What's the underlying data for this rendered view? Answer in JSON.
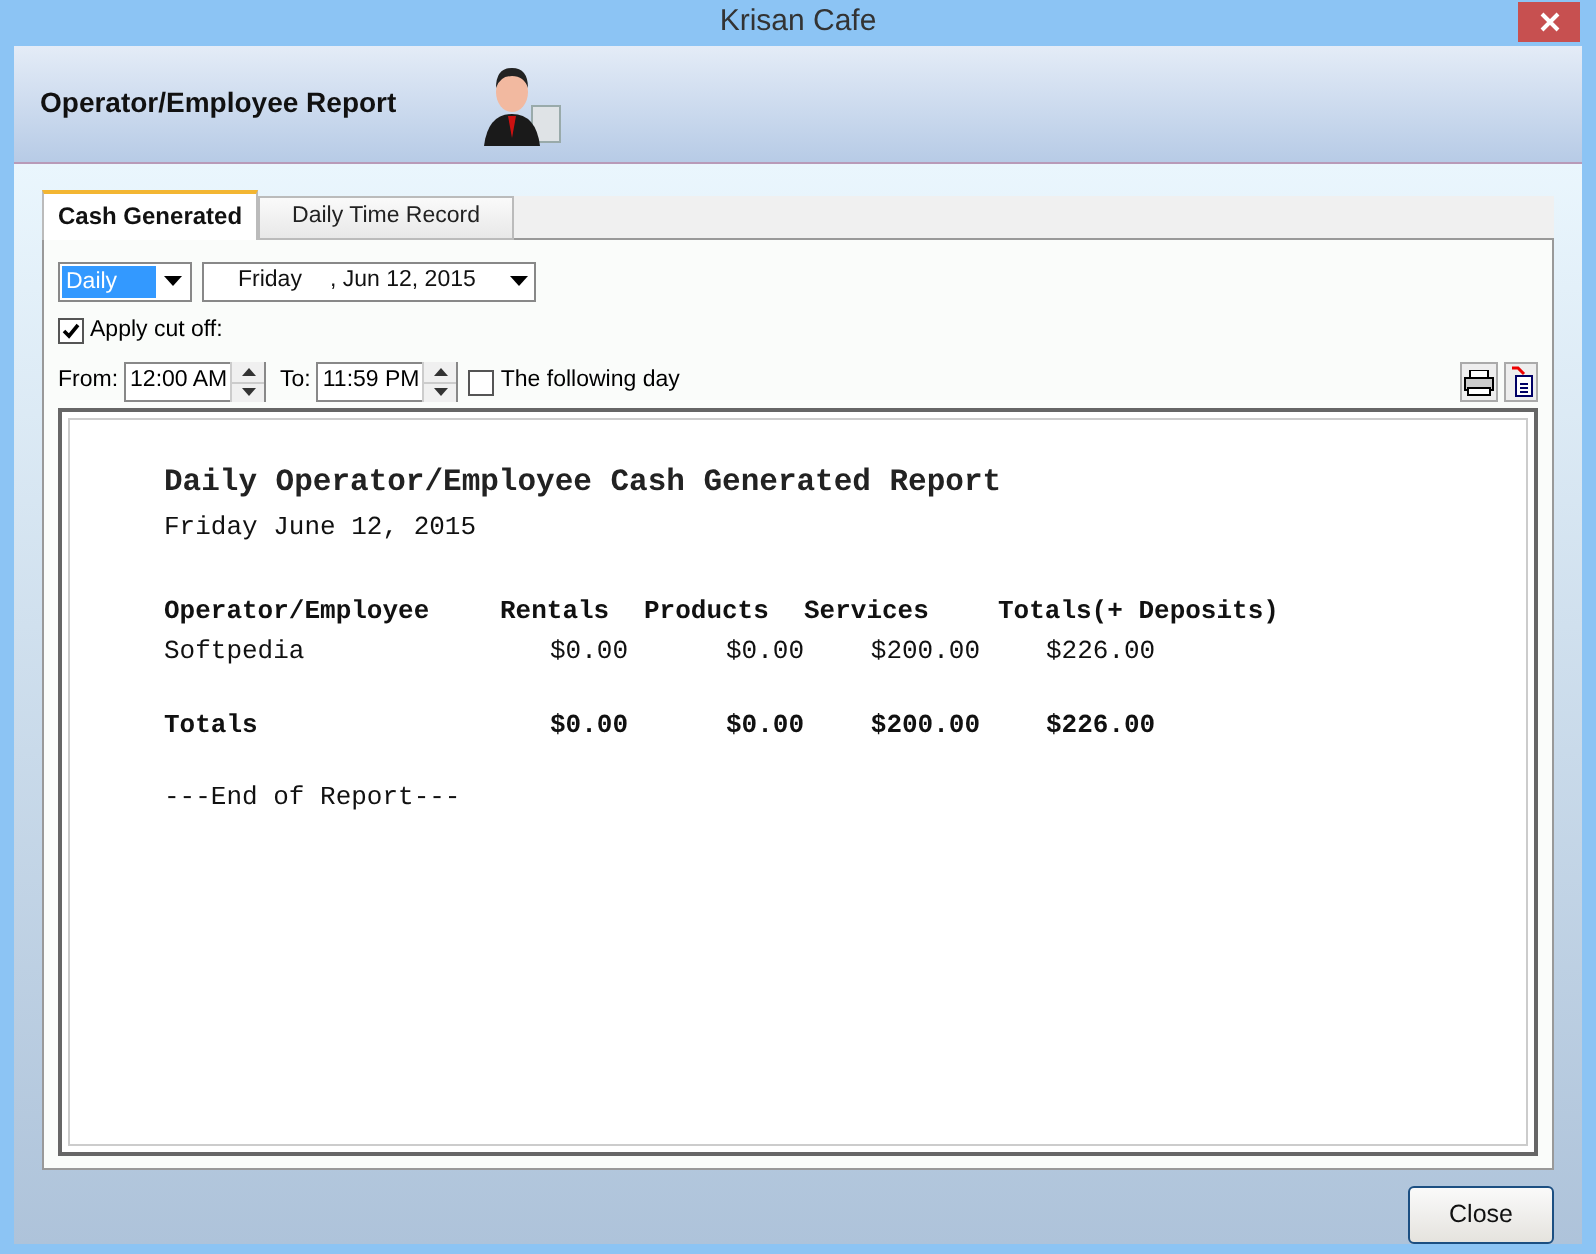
{
  "window": {
    "title": "Krisan Cafe"
  },
  "header": {
    "title": "Operator/Employee Report"
  },
  "tabs": [
    {
      "label": "Cash Generated",
      "selected": true
    },
    {
      "label": "Daily Time Record",
      "selected": false
    }
  ],
  "period": {
    "value": "Daily"
  },
  "date": {
    "day": "Friday",
    "rest": ", Jun 12, 2015"
  },
  "apply_cut_off": {
    "label": "Apply cut off:",
    "checked": true
  },
  "from": {
    "label": "From:",
    "value": "12:00 AM"
  },
  "to": {
    "label": "To:",
    "value": "11:59 PM"
  },
  "following_day": {
    "label": "The following day",
    "checked": false
  },
  "report": {
    "title": "Daily Operator/Employee Cash Generated Report",
    "date": "Friday June 12, 2015",
    "columns": [
      "Operator/Employee",
      "Rentals",
      "Products",
      "Services",
      "Totals(+ Deposits)"
    ],
    "rows": [
      [
        "Softpedia",
        "$0.00",
        "$0.00",
        "$200.00",
        "$226.00"
      ]
    ],
    "totals": [
      "Totals",
      "$0.00",
      "$0.00",
      "$200.00",
      "$226.00"
    ],
    "end": "---End of Report---"
  },
  "buttons": {
    "close": "Close"
  }
}
